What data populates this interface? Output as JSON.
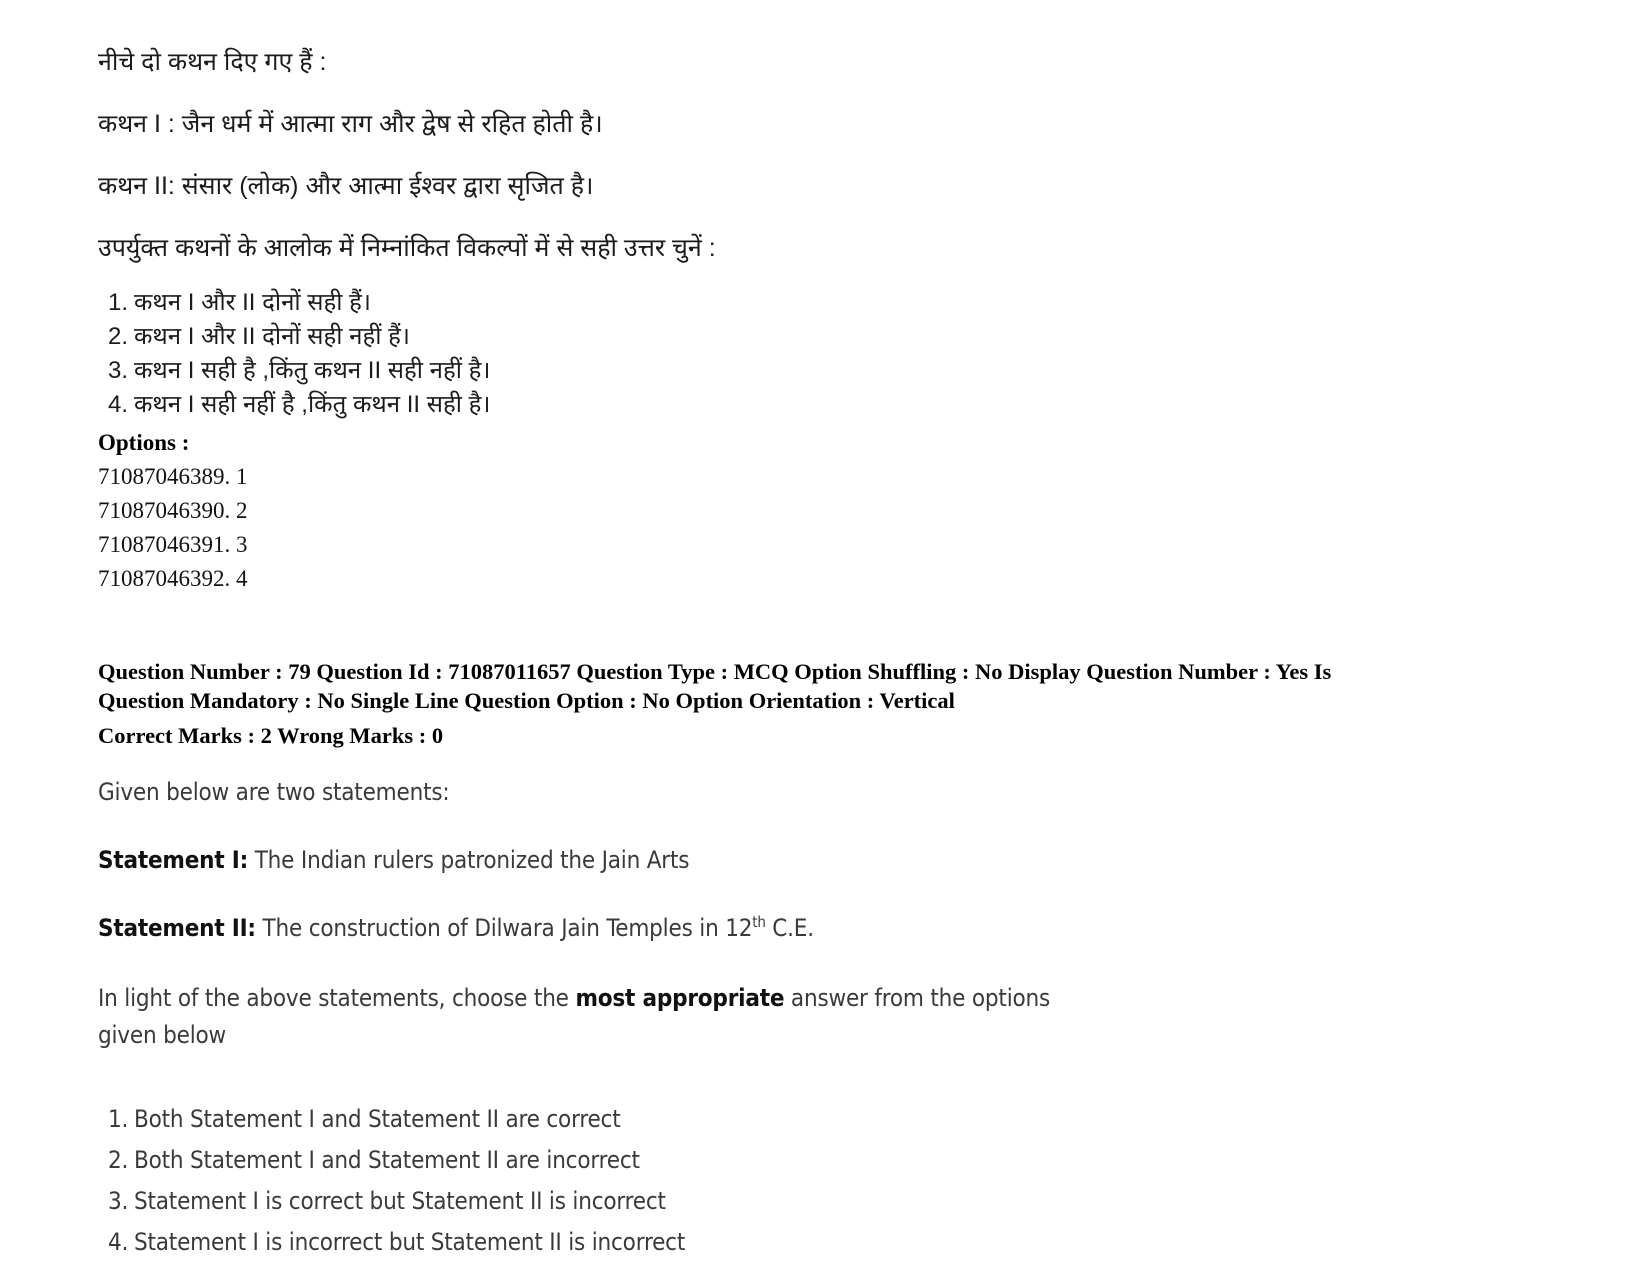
{
  "hindi": {
    "lead": "नीचे दो कथन दिए गए हैं :",
    "statement_1": "कथन I : जैन धर्म में आत्मा राग और द्वेष से रहित होती है।",
    "statement_2": "कथन  II: संसार (लोक) और आत्मा ईश्वर द्वारा सृजित है।",
    "prompt": "उपर्युक्त कथनों के आलोक में निम्नांकित विकल्पों में से  सही उत्तर चुनें :",
    "choices": [
      {
        "num": "1.",
        "text": "कथन I और II दोनों सही हैं।"
      },
      {
        "num": "2.",
        "text": "कथन I और II दोनों सही नहीं हैं।"
      },
      {
        "num": "3.",
        "text": "कथन I सही है ,किंतु कथन II सही नहीं  है।"
      },
      {
        "num": "4.",
        "text": "कथन I सही नहीं  है ,किंतु कथन II सही  है।"
      }
    ]
  },
  "options": {
    "heading": "Options :",
    "items": [
      "71087046389. 1",
      "71087046390. 2",
      "71087046391. 3",
      "71087046392. 4"
    ]
  },
  "meta": {
    "line1": "Question Number : 79 Question Id : 71087011657 Question Type : MCQ Option Shuffling : No Display Question Number : Yes Is",
    "line2": "Question Mandatory : No Single Line Question Option : No Option Orientation : Vertical",
    "line3": "Correct Marks : 2 Wrong Marks : 0",
    "question_number": "79",
    "question_id": "71087011657",
    "question_type": "MCQ",
    "option_shuffling": "No",
    "display_question_number": "Yes",
    "is_question_mandatory": "No",
    "single_line_question_option": "No",
    "option_orientation": "Vertical",
    "correct_marks": "2",
    "wrong_marks": "0"
  },
  "english": {
    "intro": "Given below are two statements:",
    "statement_1_label": "Statement I:",
    "statement_1_text": " The Indian rulers patronized the Jain Arts",
    "statement_2_label": "Statement II:",
    "statement_2_text_before": " The construction of Dilwara Jain Temples in 12",
    "statement_2_superscript": "th",
    "statement_2_text_after": "  C.E.",
    "choose_before": "In light of the above statements, choose the ",
    "choose_bold": "most appropriate",
    "choose_after": " answer from the options given below",
    "choices": [
      {
        "num": "1.",
        "text": "Both Statement I and Statement II  are correct"
      },
      {
        "num": "2.",
        "text": "Both Statement I and Statement II  are incorrect"
      },
      {
        "num": "3.",
        "text": "Statement I is correct but Statement II is incorrect"
      },
      {
        "num": "4.",
        "text": "Statement I is incorrect but Statement II is incorrect"
      }
    ]
  }
}
